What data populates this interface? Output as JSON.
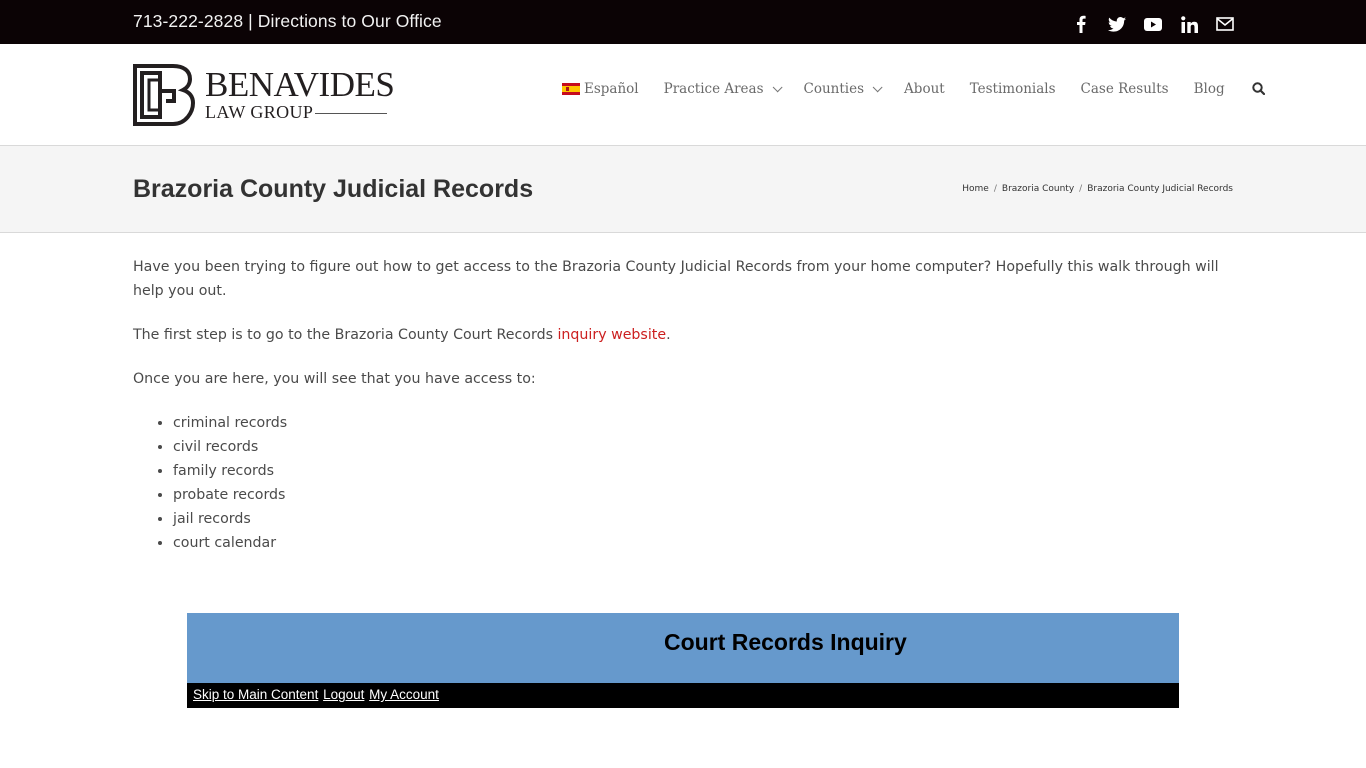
{
  "topbar": {
    "phone": "713-222-2828",
    "separator": " | ",
    "directions_link": "Directions to Our Office",
    "social_icons": [
      "facebook-icon",
      "twitter-icon",
      "youtube-icon",
      "linkedin-icon",
      "envelope-icon"
    ]
  },
  "logo": {
    "name": "BENAVIDES",
    "subtitle": "LAW GROUP"
  },
  "nav": {
    "items": [
      {
        "label": "Español",
        "icon": "spain-flag-icon"
      },
      {
        "label": "Practice Areas",
        "dropdown": true
      },
      {
        "label": "Counties",
        "dropdown": true
      },
      {
        "label": "About"
      },
      {
        "label": "Testimonials"
      },
      {
        "label": "Case Results"
      },
      {
        "label": "Blog"
      }
    ],
    "search_icon": "search-icon"
  },
  "page": {
    "title": "Brazoria County Judicial Records",
    "breadcrumb": [
      "Home",
      "Brazoria County",
      "Brazoria County Judicial Records"
    ],
    "breadcrumb_sep": "/"
  },
  "content": {
    "para1": "Have you been trying to figure out how to get access to the Brazoria County Judicial Records from your home computer?  Hopefully this walk through will help you out.",
    "para2_prefix": "The first step is to go to the Brazoria County Court Records ",
    "para2_link": "inquiry website",
    "para2_suffix": ".",
    "para3": "Once you are here, you will see that you have access to:",
    "list": [
      "criminal records",
      "civil records",
      "family records",
      "probate records",
      "jail records",
      "court calendar"
    ]
  },
  "embed": {
    "title": "Court Records Inquiry",
    "links": [
      "Skip to Main Content",
      "Logout",
      "My Account"
    ],
    "banner_color": "#6699cc"
  },
  "colors": {
    "topbar_bg": "#0b0305",
    "link_red": "#cc1f1f",
    "title_bar_bg": "#f5f5f5"
  }
}
